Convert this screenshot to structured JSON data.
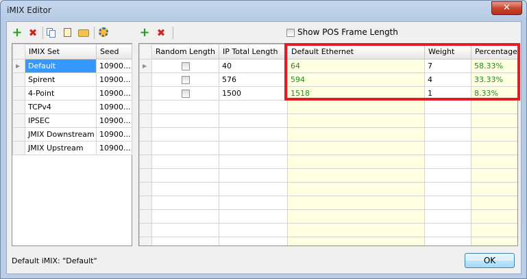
{
  "window": {
    "title": "iMIX Editor",
    "close_glyph": "✕"
  },
  "left_toolbar": {
    "add_icon": "plus-icon",
    "delete_icon": "delete-icon",
    "copy_icon": "copy-icon",
    "paste_icon": "paste-icon",
    "open_icon": "open-folder-icon",
    "settings_icon": "settings-icon"
  },
  "right_toolbar": {
    "add_icon": "plus-icon",
    "delete_icon": "delete-icon",
    "show_pos_label": "Show POS Frame Length",
    "show_pos_checked": false
  },
  "imix_table": {
    "headers": [
      "IMIX Set",
      "Seed"
    ],
    "rows": [
      {
        "name": "Default",
        "seed": "10900...",
        "selected": true
      },
      {
        "name": "Spirent",
        "seed": "10900...",
        "selected": false
      },
      {
        "name": "4-Point",
        "seed": "10900...",
        "selected": false
      },
      {
        "name": "TCPv4",
        "seed": "10900...",
        "selected": false
      },
      {
        "name": "IPSEC",
        "seed": "10900...",
        "selected": false
      },
      {
        "name": "JMIX Downstream",
        "seed": "10900...",
        "selected": false
      },
      {
        "name": "JMIX Upstream",
        "seed": "10900...",
        "selected": false
      }
    ]
  },
  "frame_table": {
    "headers": [
      "Random Length",
      "IP Total Length",
      "Default Ethernet",
      "Weight",
      "Percentage"
    ],
    "rows": [
      {
        "random": false,
        "ip_total_length": "40",
        "default_ethernet": "64",
        "weight": "7",
        "percentage": "58.33%"
      },
      {
        "random": false,
        "ip_total_length": "576",
        "default_ethernet": "594",
        "weight": "4",
        "percentage": "33.33%"
      },
      {
        "random": false,
        "ip_total_length": "1500",
        "default_ethernet": "1518",
        "weight": "1",
        "percentage": "8.33%"
      }
    ]
  },
  "status": {
    "label": "Default iMIX:  \"Default\""
  },
  "buttons": {
    "ok": "OK"
  },
  "colors": {
    "selection": "#3399ff",
    "highlight_box": "#e31b23",
    "computed_cell_bg": "#ffffe1",
    "computed_text": "#1f8b1f"
  }
}
